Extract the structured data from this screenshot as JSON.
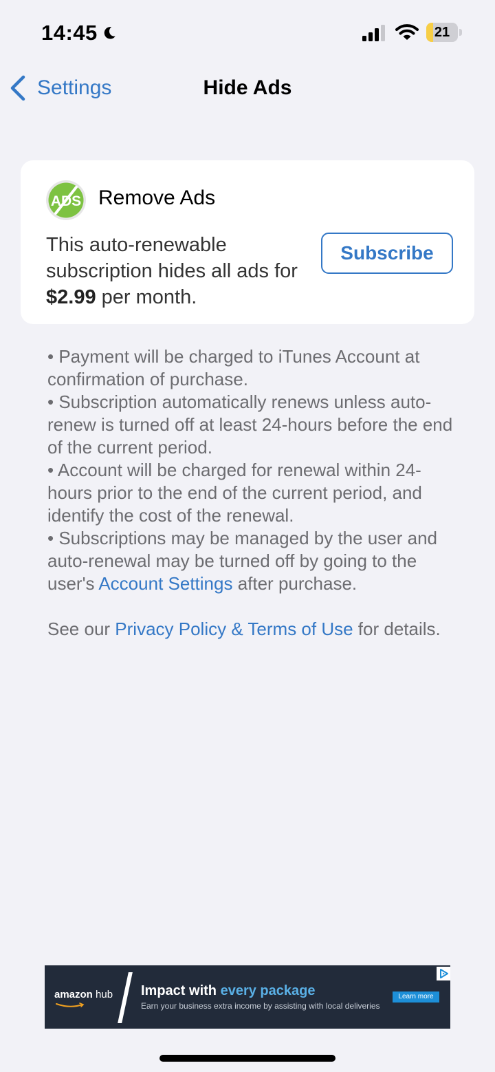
{
  "status_bar": {
    "time": "14:45",
    "battery_percent": "21",
    "battery_level": 0.21,
    "icons": [
      "moon-icon",
      "cellular-signal-icon",
      "wifi-icon",
      "battery-icon"
    ]
  },
  "nav": {
    "back_label": "Settings",
    "back_icon": "chevron-left-icon",
    "title": "Hide Ads"
  },
  "product": {
    "icon": "no-ads-icon",
    "icon_text": "ADS",
    "title": "Remove Ads",
    "desc_before_price": "This auto-renewable subscription hides all ads for ",
    "price": "$2.99",
    "desc_after_price": " per month.",
    "subscribe_label": "Subscribe"
  },
  "terms": {
    "bullet_1": "• Payment will be charged to iTunes Account at confirmation of purchase.",
    "bullet_2": "• Subscription automatically renews unless auto-renew is turned off at least 24-hours before the end of the current period.",
    "bullet_3": "• Account will be charged for renewal within 24-hours prior to the end of the current period, and identify the cost of the renewal.",
    "bullet_4_before": "• Subscriptions may be managed by the user and auto-renewal may be turned off by going to the user's ",
    "bullet_4_link": "Account Settings",
    "bullet_4_after": " after purchase.",
    "footer_before": "See our ",
    "footer_link": "Privacy Policy & Terms of Use",
    "footer_after": " for details."
  },
  "ad": {
    "brand_bold": "amazon",
    "brand_light": " hub",
    "headline_before": "Impact with ",
    "headline_accent": "every package",
    "subline": "Earn your business extra income by assisting with local deliveries",
    "cta": "Learn more",
    "choices_icon": "adchoices-icon"
  },
  "colors": {
    "accent": "#3478c6",
    "background": "#f2f2f7",
    "card": "#ffffff",
    "secondary_text": "#6c6c70",
    "battery_fill": "#f7ce46",
    "ad_background": "#222b3a",
    "icon_green": "#7dc241"
  }
}
